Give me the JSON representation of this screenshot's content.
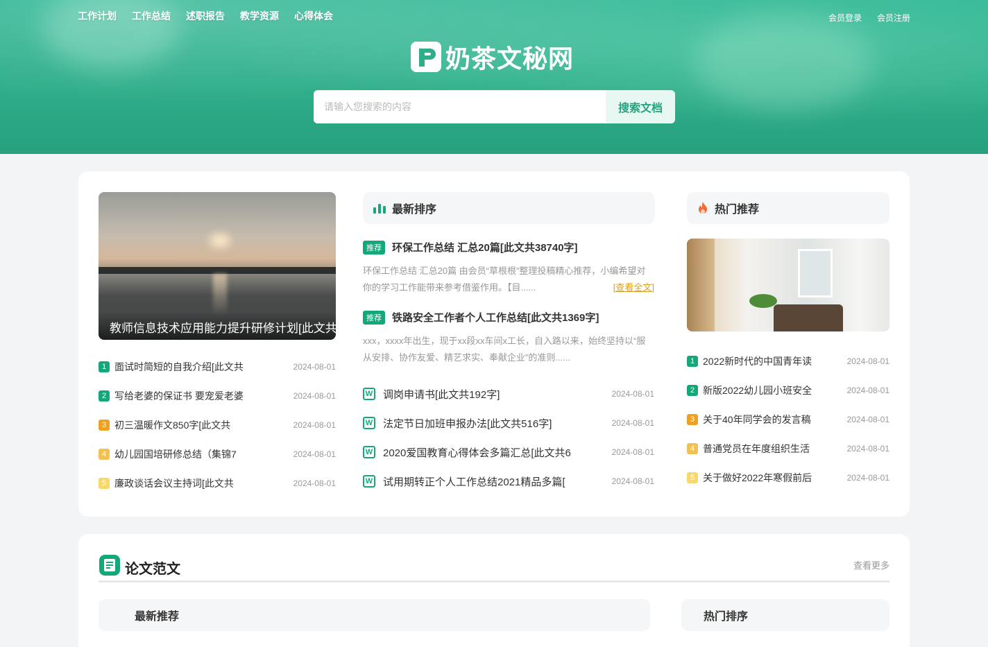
{
  "nav": [
    "工作计划",
    "工作总结",
    "述职报告",
    "教学资源",
    "心得体会"
  ],
  "user": {
    "login": "会员登录",
    "register": "会员注册"
  },
  "logo": {
    "text": "奶茶文秘网"
  },
  "search": {
    "placeholder": "请输入您搜索的内容",
    "button": "搜索文档"
  },
  "featured": {
    "caption": "教师信息技术应用能力提升研修计划[此文共"
  },
  "left_list": [
    {
      "num": "1",
      "title": "面试时简短的自我介绍[此文共",
      "date": "2024-08-01"
    },
    {
      "num": "2",
      "title": "写给老婆的保证书 要宠爱老婆",
      "date": "2024-08-01"
    },
    {
      "num": "3",
      "title": "初三温暖作文850字[此文共",
      "date": "2024-08-01"
    },
    {
      "num": "4",
      "title": "幼儿园国培研修总结（集锦7",
      "date": "2024-08-01"
    },
    {
      "num": "5",
      "title": "廉政谈话会议主持词[此文共",
      "date": "2024-08-01"
    }
  ],
  "latest": {
    "heading": "最新排序",
    "items": [
      {
        "tag": "推荐",
        "title": "环保工作总结 汇总20篇[此文共38740字]",
        "excerpt": "环保工作总结 汇总20篇 由会员“草根根”整理投稿精心推荐，小编希望对你的学习工作能带来参考借鉴作用。【目......",
        "more": "[查看全文]"
      },
      {
        "tag": "推荐",
        "title": "铁路安全工作者个人工作总结[此文共1369字]",
        "excerpt": "xxx，xxxx年出生，现于xx段xx车间x工长，自入路以来，始终坚持以“服从安排、协作友爱、精艺求实、奉献企业”的准则......"
      }
    ],
    "docs": [
      {
        "title": "调岗申请书[此文共192字]",
        "date": "2024-08-01"
      },
      {
        "title": "法定节日加班申报办法[此文共516字]",
        "date": "2024-08-01"
      },
      {
        "title": "2020爱国教育心得体会多篇汇总[此文共6",
        "date": "2024-08-01"
      },
      {
        "title": "试用期转正个人工作总结2021精品多篇[",
        "date": "2024-08-01"
      }
    ]
  },
  "hot": {
    "heading": "热门推荐",
    "items": [
      {
        "num": "1",
        "title": "2022新时代的中国青年读",
        "date": "2024-08-01"
      },
      {
        "num": "2",
        "title": "新版2022幼儿园小班安全",
        "date": "2024-08-01"
      },
      {
        "num": "3",
        "title": "关于40年同学会的发言稿",
        "date": "2024-08-01"
      },
      {
        "num": "4",
        "title": "普通党员在年度组织生活",
        "date": "2024-08-01"
      },
      {
        "num": "5",
        "title": "关于做好2022年寒假前后",
        "date": "2024-08-01"
      }
    ]
  },
  "section2": {
    "title": "论文范文",
    "more": "查看更多",
    "sub_left": "最新推荐",
    "sub_right": "热门排序"
  },
  "colors": {
    "brand": "#14a77a",
    "header_bg": "#2fae8a",
    "tag_orange": "#f0a020"
  }
}
